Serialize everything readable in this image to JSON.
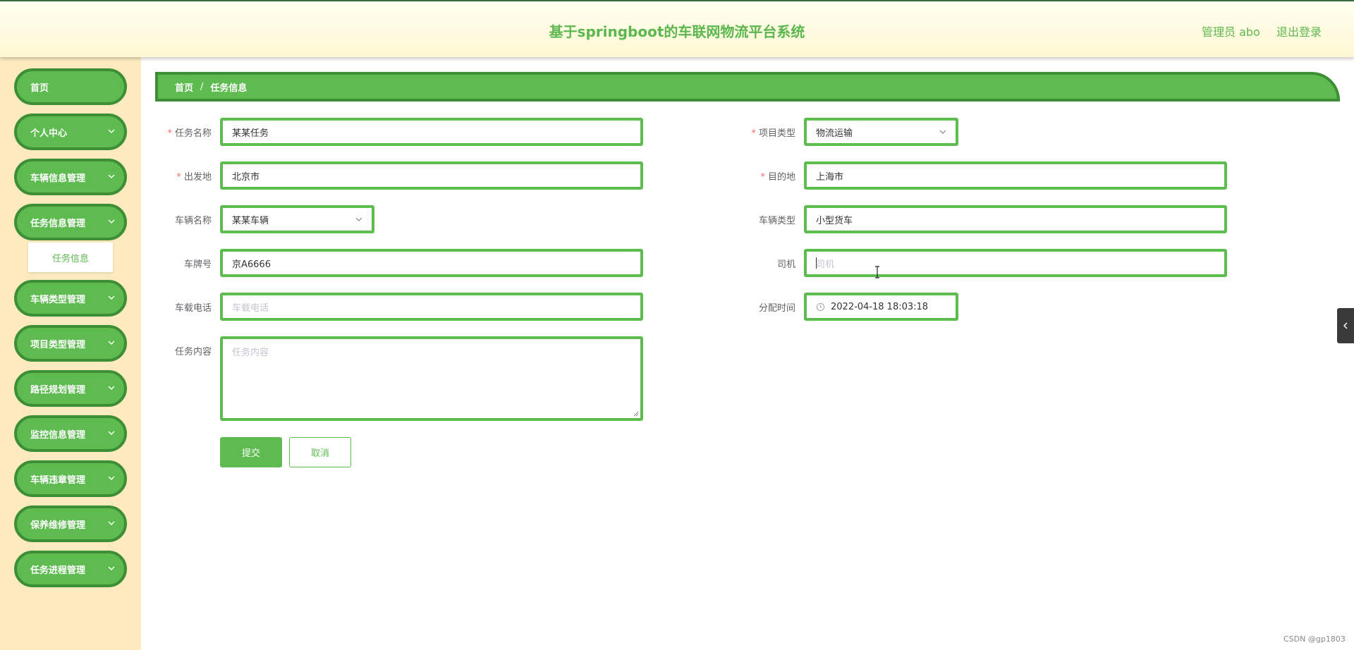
{
  "header": {
    "title": "基于springboot的车联网物流平台系统",
    "admin_label": "管理员 abo",
    "logout_label": "退出登录"
  },
  "sidebar": {
    "items": [
      {
        "label": "首页",
        "has_children": false
      },
      {
        "label": "个人中心",
        "has_children": true
      },
      {
        "label": "车辆信息管理",
        "has_children": true
      },
      {
        "label": "任务信息管理",
        "has_children": true
      },
      {
        "label": "车辆类型管理",
        "has_children": true
      },
      {
        "label": "项目类型管理",
        "has_children": true
      },
      {
        "label": "路径规划管理",
        "has_children": true
      },
      {
        "label": "监控信息管理",
        "has_children": true
      },
      {
        "label": "车辆违章管理",
        "has_children": true
      },
      {
        "label": "保养维修管理",
        "has_children": true
      },
      {
        "label": "任务进程管理",
        "has_children": true
      }
    ],
    "submenu_label": "任务信息"
  },
  "breadcrumb": {
    "home": "首页",
    "separator": "/",
    "current": "任务信息"
  },
  "form": {
    "task_name": {
      "label": "任务名称",
      "required": true,
      "value": "某某任务"
    },
    "project_type": {
      "label": "项目类型",
      "required": true,
      "value": "物流运输"
    },
    "origin": {
      "label": "出发地",
      "required": true,
      "value": "北京市"
    },
    "destination": {
      "label": "目的地",
      "required": true,
      "value": "上海市"
    },
    "vehicle_name": {
      "label": "车辆名称",
      "required": false,
      "value": "某某车辆"
    },
    "vehicle_type": {
      "label": "车辆类型",
      "required": false,
      "value": "小型货车"
    },
    "plate": {
      "label": "车牌号",
      "required": false,
      "value": "京A6666"
    },
    "driver": {
      "label": "司机",
      "required": false,
      "value": "",
      "placeholder": "司机"
    },
    "phone": {
      "label": "车载电话",
      "required": false,
      "value": "",
      "placeholder": "车载电话"
    },
    "assign_time": {
      "label": "分配时间",
      "required": false,
      "value": "2022-04-18 18:03:18"
    },
    "content": {
      "label": "任务内容",
      "required": false,
      "value": "",
      "placeholder": "任务内容"
    },
    "required_mark": "*",
    "submit_label": "提交",
    "cancel_label": "取消"
  },
  "watermark": "CSDN @gp1803",
  "colors": {
    "accent": "#5dbb50",
    "accent_border": "#3d8e35",
    "sidebar_bg": "#fdebbf",
    "header_text": "#5db750",
    "required": "#f56c6c"
  },
  "icons": {
    "menu_expand": "chevron-down-icon",
    "select": "chevron-down-icon",
    "clock": "clock-icon",
    "side_tab": "chevron-left-icon"
  }
}
